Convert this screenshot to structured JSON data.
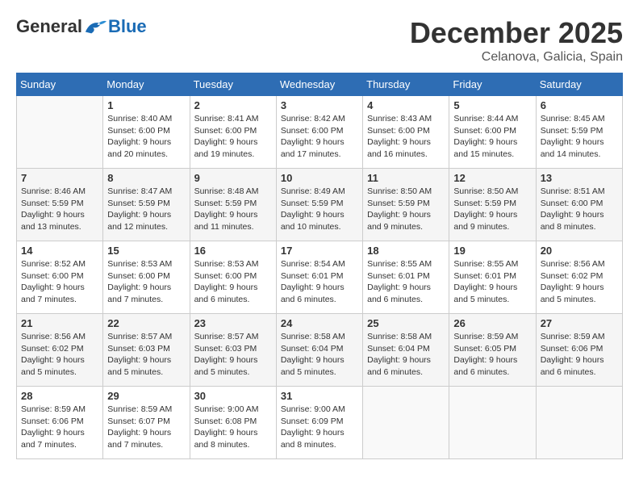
{
  "logo": {
    "general": "General",
    "blue": "Blue"
  },
  "title": "December 2025",
  "location": "Celanova, Galicia, Spain",
  "days_header": [
    "Sunday",
    "Monday",
    "Tuesday",
    "Wednesday",
    "Thursday",
    "Friday",
    "Saturday"
  ],
  "weeks": [
    [
      {
        "day": "",
        "sunrise": "",
        "sunset": "",
        "daylight": ""
      },
      {
        "day": "1",
        "sunrise": "Sunrise: 8:40 AM",
        "sunset": "Sunset: 6:00 PM",
        "daylight": "Daylight: 9 hours and 20 minutes."
      },
      {
        "day": "2",
        "sunrise": "Sunrise: 8:41 AM",
        "sunset": "Sunset: 6:00 PM",
        "daylight": "Daylight: 9 hours and 19 minutes."
      },
      {
        "day": "3",
        "sunrise": "Sunrise: 8:42 AM",
        "sunset": "Sunset: 6:00 PM",
        "daylight": "Daylight: 9 hours and 17 minutes."
      },
      {
        "day": "4",
        "sunrise": "Sunrise: 8:43 AM",
        "sunset": "Sunset: 6:00 PM",
        "daylight": "Daylight: 9 hours and 16 minutes."
      },
      {
        "day": "5",
        "sunrise": "Sunrise: 8:44 AM",
        "sunset": "Sunset: 6:00 PM",
        "daylight": "Daylight: 9 hours and 15 minutes."
      },
      {
        "day": "6",
        "sunrise": "Sunrise: 8:45 AM",
        "sunset": "Sunset: 5:59 PM",
        "daylight": "Daylight: 9 hours and 14 minutes."
      }
    ],
    [
      {
        "day": "7",
        "sunrise": "Sunrise: 8:46 AM",
        "sunset": "Sunset: 5:59 PM",
        "daylight": "Daylight: 9 hours and 13 minutes."
      },
      {
        "day": "8",
        "sunrise": "Sunrise: 8:47 AM",
        "sunset": "Sunset: 5:59 PM",
        "daylight": "Daylight: 9 hours and 12 minutes."
      },
      {
        "day": "9",
        "sunrise": "Sunrise: 8:48 AM",
        "sunset": "Sunset: 5:59 PM",
        "daylight": "Daylight: 9 hours and 11 minutes."
      },
      {
        "day": "10",
        "sunrise": "Sunrise: 8:49 AM",
        "sunset": "Sunset: 5:59 PM",
        "daylight": "Daylight: 9 hours and 10 minutes."
      },
      {
        "day": "11",
        "sunrise": "Sunrise: 8:50 AM",
        "sunset": "Sunset: 5:59 PM",
        "daylight": "Daylight: 9 hours and 9 minutes."
      },
      {
        "day": "12",
        "sunrise": "Sunrise: 8:50 AM",
        "sunset": "Sunset: 5:59 PM",
        "daylight": "Daylight: 9 hours and 9 minutes."
      },
      {
        "day": "13",
        "sunrise": "Sunrise: 8:51 AM",
        "sunset": "Sunset: 6:00 PM",
        "daylight": "Daylight: 9 hours and 8 minutes."
      }
    ],
    [
      {
        "day": "14",
        "sunrise": "Sunrise: 8:52 AM",
        "sunset": "Sunset: 6:00 PM",
        "daylight": "Daylight: 9 hours and 7 minutes."
      },
      {
        "day": "15",
        "sunrise": "Sunrise: 8:53 AM",
        "sunset": "Sunset: 6:00 PM",
        "daylight": "Daylight: 9 hours and 7 minutes."
      },
      {
        "day": "16",
        "sunrise": "Sunrise: 8:53 AM",
        "sunset": "Sunset: 6:00 PM",
        "daylight": "Daylight: 9 hours and 6 minutes."
      },
      {
        "day": "17",
        "sunrise": "Sunrise: 8:54 AM",
        "sunset": "Sunset: 6:01 PM",
        "daylight": "Daylight: 9 hours and 6 minutes."
      },
      {
        "day": "18",
        "sunrise": "Sunrise: 8:55 AM",
        "sunset": "Sunset: 6:01 PM",
        "daylight": "Daylight: 9 hours and 6 minutes."
      },
      {
        "day": "19",
        "sunrise": "Sunrise: 8:55 AM",
        "sunset": "Sunset: 6:01 PM",
        "daylight": "Daylight: 9 hours and 5 minutes."
      },
      {
        "day": "20",
        "sunrise": "Sunrise: 8:56 AM",
        "sunset": "Sunset: 6:02 PM",
        "daylight": "Daylight: 9 hours and 5 minutes."
      }
    ],
    [
      {
        "day": "21",
        "sunrise": "Sunrise: 8:56 AM",
        "sunset": "Sunset: 6:02 PM",
        "daylight": "Daylight: 9 hours and 5 minutes."
      },
      {
        "day": "22",
        "sunrise": "Sunrise: 8:57 AM",
        "sunset": "Sunset: 6:03 PM",
        "daylight": "Daylight: 9 hours and 5 minutes."
      },
      {
        "day": "23",
        "sunrise": "Sunrise: 8:57 AM",
        "sunset": "Sunset: 6:03 PM",
        "daylight": "Daylight: 9 hours and 5 minutes."
      },
      {
        "day": "24",
        "sunrise": "Sunrise: 8:58 AM",
        "sunset": "Sunset: 6:04 PM",
        "daylight": "Daylight: 9 hours and 5 minutes."
      },
      {
        "day": "25",
        "sunrise": "Sunrise: 8:58 AM",
        "sunset": "Sunset: 6:04 PM",
        "daylight": "Daylight: 9 hours and 6 minutes."
      },
      {
        "day": "26",
        "sunrise": "Sunrise: 8:59 AM",
        "sunset": "Sunset: 6:05 PM",
        "daylight": "Daylight: 9 hours and 6 minutes."
      },
      {
        "day": "27",
        "sunrise": "Sunrise: 8:59 AM",
        "sunset": "Sunset: 6:06 PM",
        "daylight": "Daylight: 9 hours and 6 minutes."
      }
    ],
    [
      {
        "day": "28",
        "sunrise": "Sunrise: 8:59 AM",
        "sunset": "Sunset: 6:06 PM",
        "daylight": "Daylight: 9 hours and 7 minutes."
      },
      {
        "day": "29",
        "sunrise": "Sunrise: 8:59 AM",
        "sunset": "Sunset: 6:07 PM",
        "daylight": "Daylight: 9 hours and 7 minutes."
      },
      {
        "day": "30",
        "sunrise": "Sunrise: 9:00 AM",
        "sunset": "Sunset: 6:08 PM",
        "daylight": "Daylight: 9 hours and 8 minutes."
      },
      {
        "day": "31",
        "sunrise": "Sunrise: 9:00 AM",
        "sunset": "Sunset: 6:09 PM",
        "daylight": "Daylight: 9 hours and 8 minutes."
      },
      {
        "day": "",
        "sunrise": "",
        "sunset": "",
        "daylight": ""
      },
      {
        "day": "",
        "sunrise": "",
        "sunset": "",
        "daylight": ""
      },
      {
        "day": "",
        "sunrise": "",
        "sunset": "",
        "daylight": ""
      }
    ]
  ]
}
